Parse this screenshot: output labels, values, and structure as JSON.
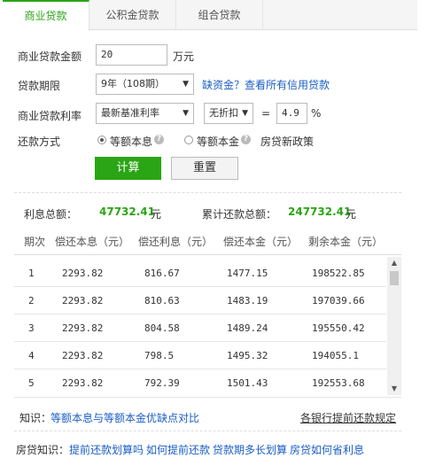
{
  "tabs": [
    {
      "label": "商业贷款"
    },
    {
      "label": "公积金贷款"
    },
    {
      "label": "组合贷款"
    }
  ],
  "form": {
    "amount_label": "商业贷款金额",
    "amount_value": "20",
    "amount_unit": "万元",
    "term_label": "贷款期限",
    "term_value": "9年（108期）",
    "term_link": "缺资金？查看所有信用贷款",
    "rate_label": "商业贷款利率",
    "rate_select": "最新基准利率",
    "discount_select": "无折扣",
    "equals": "=",
    "rate_value": "4.9",
    "rate_unit": "%",
    "method_label": "还款方式",
    "method_option1": "等额本息",
    "method_option2": "等额本金",
    "policy_link": "房贷新政策",
    "calc_button": "计算",
    "reset_button": "重置"
  },
  "summary": {
    "interest_label": "利息总额：",
    "interest_value": "47732.41",
    "interest_unit": "元",
    "total_label": "累计还款总额：",
    "total_value": "247732.41",
    "total_unit": "元"
  },
  "table": {
    "headers": [
      "期次",
      "偿还本息（元）",
      "偿还利息（元）",
      "偿还本金（元）",
      "剩余本金（元）"
    ],
    "rows": [
      [
        "1",
        "2293.82",
        "816.67",
        "1477.15",
        "198522.85"
      ],
      [
        "2",
        "2293.82",
        "810.63",
        "1483.19",
        "197039.66"
      ],
      [
        "3",
        "2293.82",
        "804.58",
        "1489.24",
        "195550.42"
      ],
      [
        "4",
        "2293.82",
        "798.5",
        "1495.32",
        "194055.1"
      ],
      [
        "5",
        "2293.82",
        "792.39",
        "1501.43",
        "192553.68"
      ]
    ]
  },
  "footer": {
    "knowledge_label": "知识：",
    "knowledge_link": "等额本息与等额本金优缺点对比",
    "bank_link": "各银行提前还款规定",
    "mortgage_label": "房贷知识：",
    "links": [
      "提前还款划算吗",
      "如何提前还款",
      "贷款期多长划算",
      "房贷如何省利息"
    ]
  },
  "colors": {
    "accent": "#2aa515",
    "link": "#1a5ec6"
  }
}
